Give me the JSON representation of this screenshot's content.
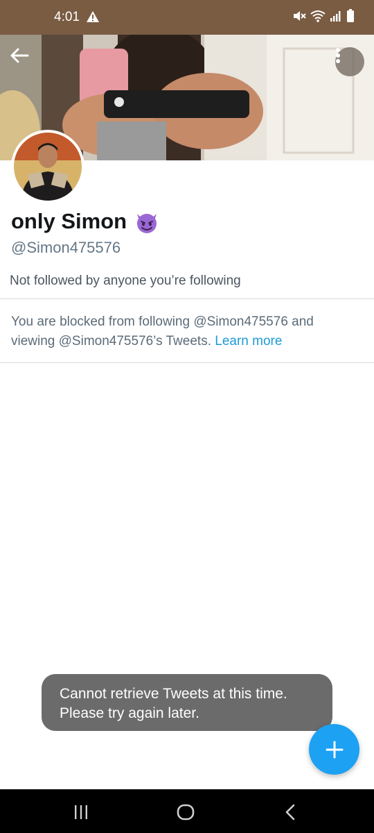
{
  "status_bar": {
    "time": "4:01",
    "icons": [
      "warning-icon",
      "mute-icon",
      "wifi-icon",
      "signal-icon",
      "battery-icon"
    ]
  },
  "header": {
    "back_icon": "arrow-left-icon",
    "more_icon": "more-vertical-icon"
  },
  "profile": {
    "display_name": "only Simon",
    "name_emoji": "smiling-devil-emoji",
    "handle": "@Simon475576",
    "followed_by": "Not followed by anyone you’re following"
  },
  "blocked_notice": {
    "text": "You are blocked from following @Simon475576 and viewing @Simon475576’s Tweets.",
    "link": "Learn more"
  },
  "toast": {
    "line1": "Cannot retrieve Tweets at this time.",
    "line2": "Please try again later."
  },
  "fab": {
    "icon": "plus-icon"
  },
  "nav_bar": {
    "items": [
      "recent-apps-icon",
      "home-icon",
      "back-icon"
    ]
  },
  "colors": {
    "status_bar": "#7a5c43",
    "accent": "#1da1f2",
    "link": "#1d9bd6",
    "toast": "#6b6b6b"
  }
}
